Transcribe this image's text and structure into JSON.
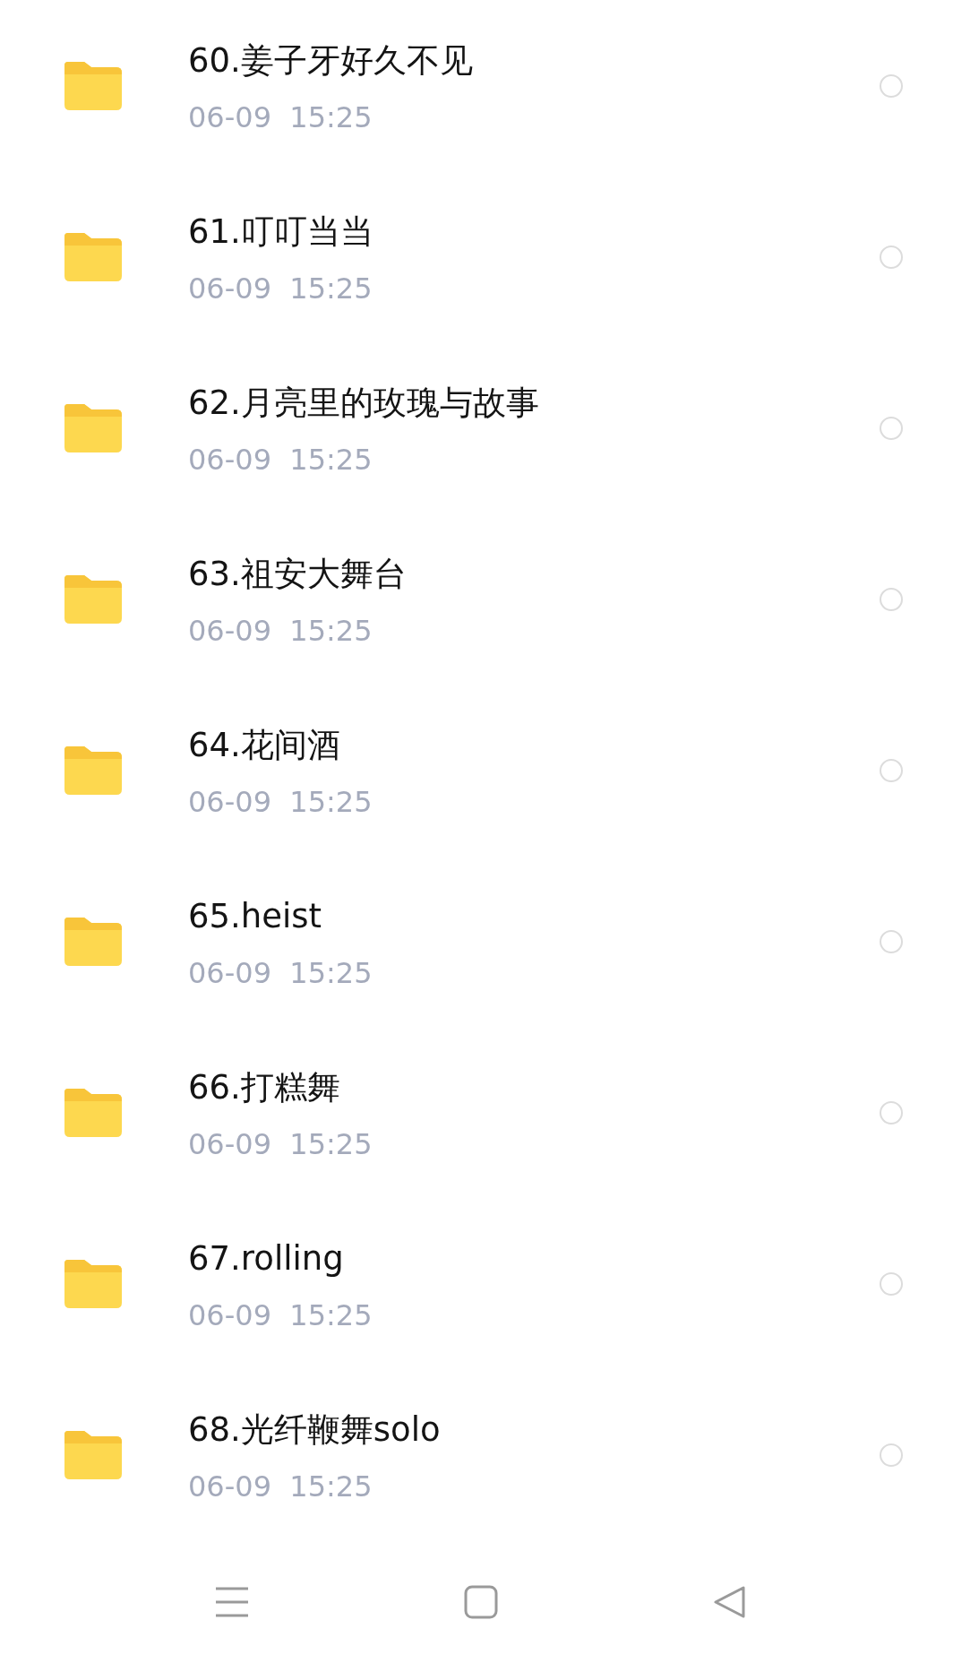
{
  "folders": [
    {
      "name": "60.姜子牙好久不见",
      "date": "06-09  15:25",
      "selected": false
    },
    {
      "name": "61.叮叮当当",
      "date": "06-09  15:25",
      "selected": false
    },
    {
      "name": "62.月亮里的玫瑰与故事",
      "date": "06-09  15:25",
      "selected": false
    },
    {
      "name": "63.祖安大舞台",
      "date": "06-09  15:25",
      "selected": false
    },
    {
      "name": "64.花间酒",
      "date": "06-09  15:25",
      "selected": false
    },
    {
      "name": "65.heist",
      "date": "06-09  15:25",
      "selected": false
    },
    {
      "name": "66.打糕舞",
      "date": "06-09  15:25",
      "selected": false
    },
    {
      "name": "67.rolling",
      "date": "06-09  15:25",
      "selected": false
    },
    {
      "name": "68.光纤鞭舞solo",
      "date": "06-09  15:25",
      "selected": false
    }
  ]
}
